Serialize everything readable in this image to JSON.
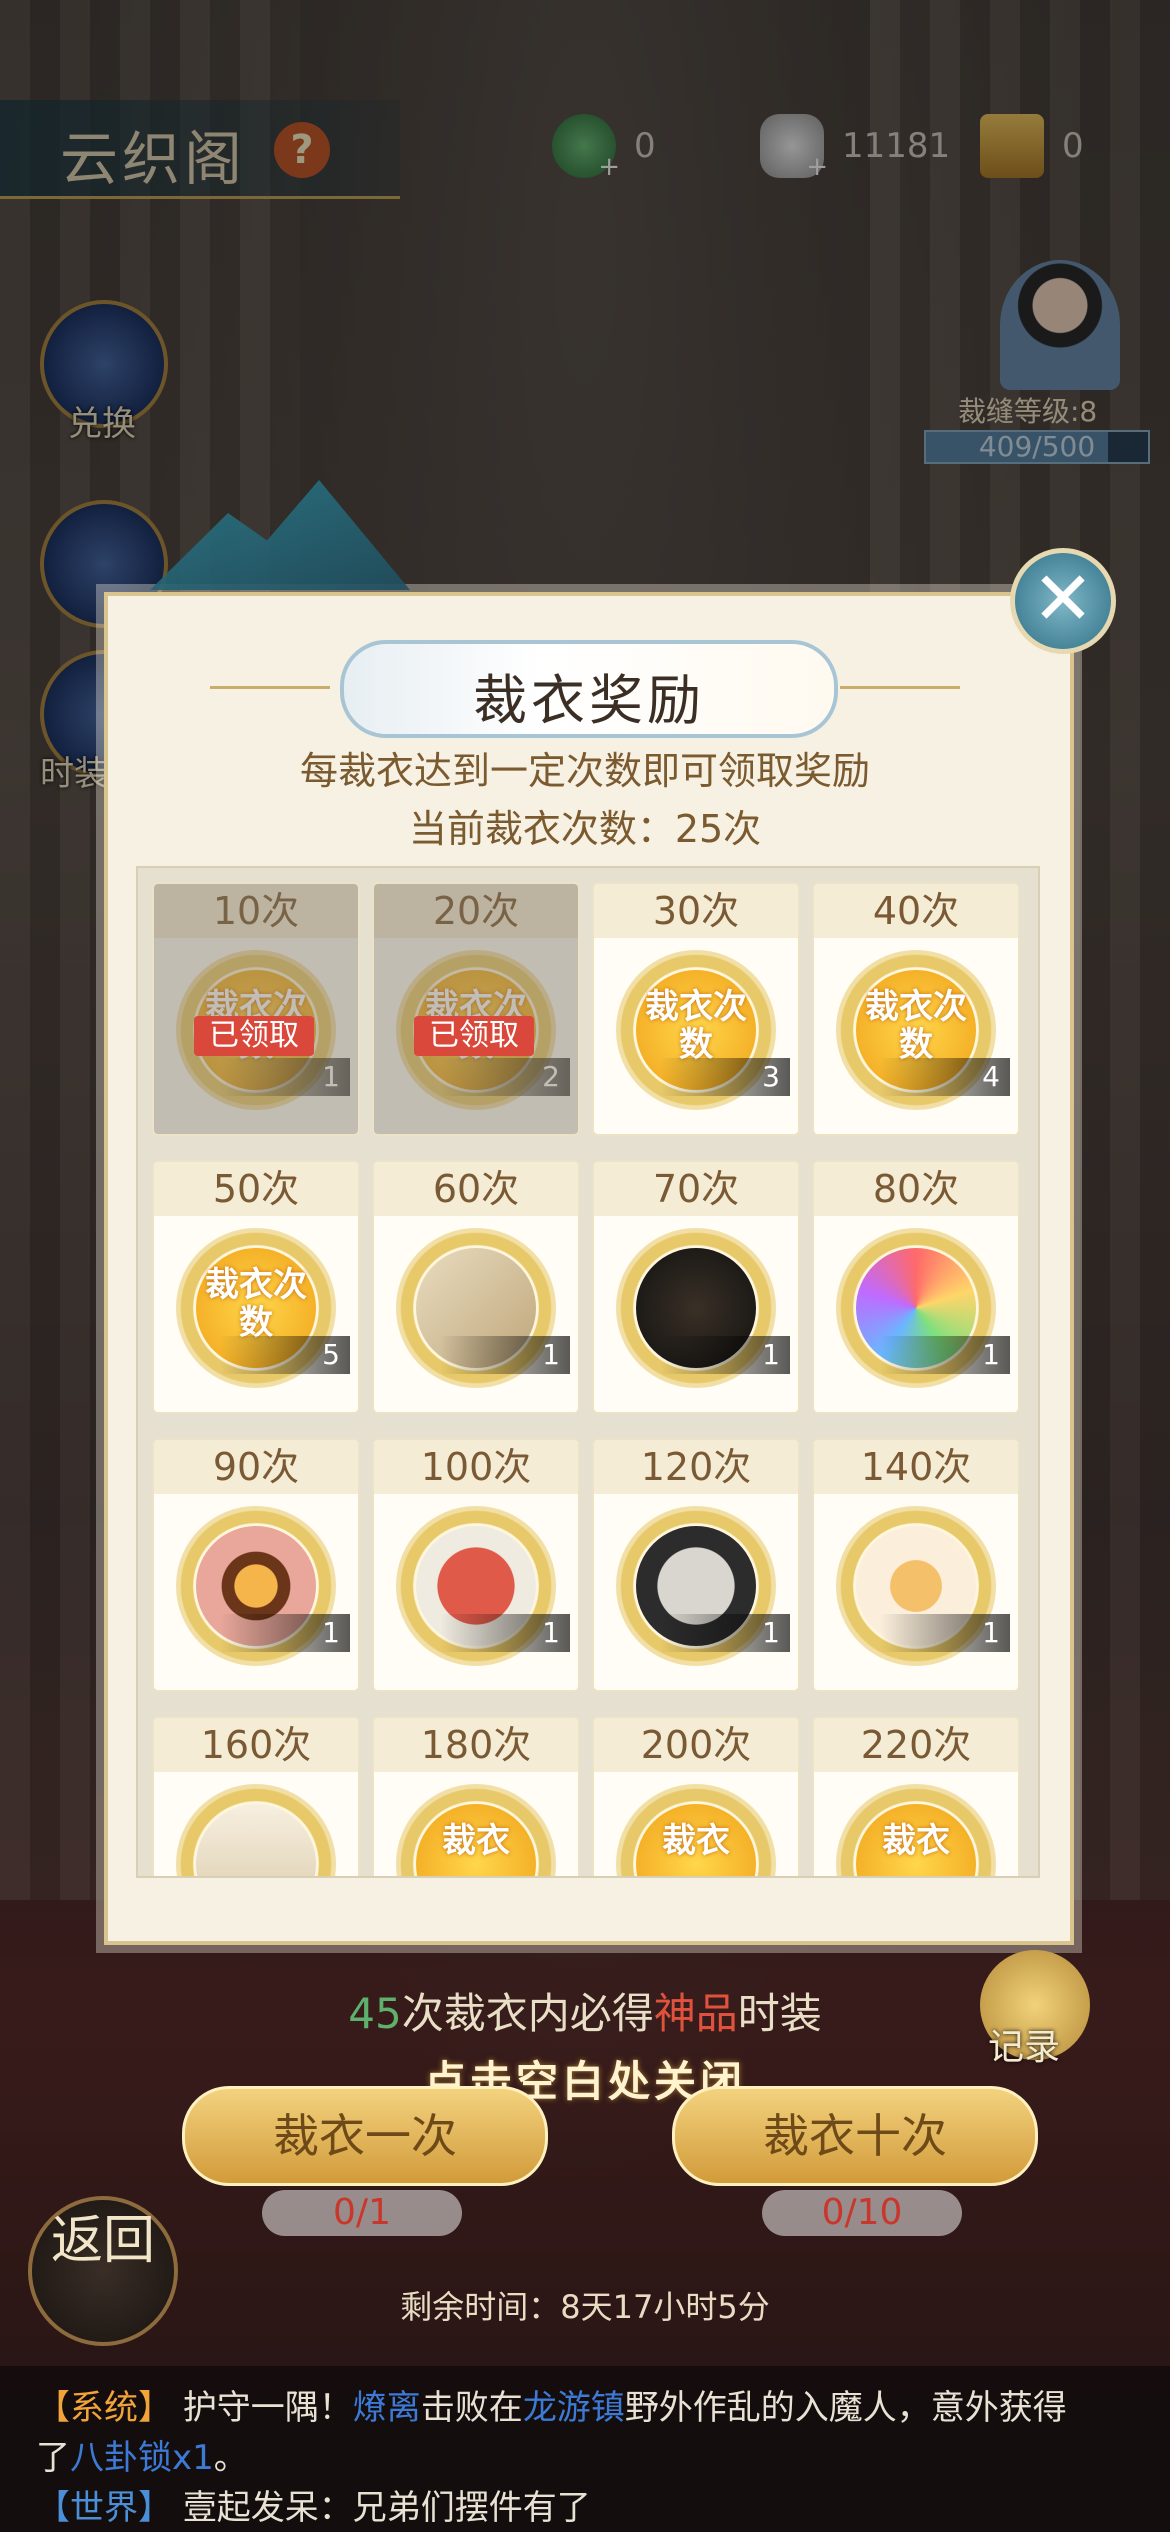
{
  "header": {
    "page_title": "云织阁",
    "help": "?",
    "currencies": [
      {
        "icon": "jade-coin-icon",
        "value": "0"
      },
      {
        "icon": "silver-ingot-icon",
        "value": "11181"
      },
      {
        "icon": "scroll-ticket-icon",
        "value": "0"
      }
    ]
  },
  "side": {
    "exchange_label": "兑换",
    "costume_label": "时装",
    "level_label": "裁缝等级:8",
    "xp_text": "409/500",
    "xp_fraction": 0.818
  },
  "modal": {
    "title": "裁衣奖励",
    "line1": "每裁衣达到一定次数即可领取奖励",
    "line2": "当前裁衣次数：25次",
    "claimed_label": "已领取",
    "cells": [
      {
        "label": "10次",
        "qty": "1",
        "kind": "ticket",
        "tag": "裁衣次数",
        "claimed": true
      },
      {
        "label": "20次",
        "qty": "2",
        "kind": "ticket",
        "tag": "裁衣次数",
        "claimed": true
      },
      {
        "label": "30次",
        "qty": "3",
        "kind": "ticket",
        "tag": "裁衣次数",
        "claimed": false
      },
      {
        "label": "40次",
        "qty": "4",
        "kind": "ticket",
        "tag": "裁衣次数",
        "claimed": false
      },
      {
        "label": "50次",
        "qty": "5",
        "kind": "ticket",
        "tag": "裁衣次数",
        "claimed": false
      },
      {
        "label": "60次",
        "qty": "1",
        "kind": "hairpin-box",
        "tag": "",
        "claimed": false
      },
      {
        "label": "70次",
        "qty": "1",
        "kind": "jewel-box",
        "tag": "",
        "claimed": false
      },
      {
        "label": "80次",
        "qty": "1",
        "kind": "rainbow-palette",
        "tag": "",
        "claimed": false
      },
      {
        "label": "90次",
        "qty": "1",
        "kind": "mirror",
        "tag": "",
        "claimed": false
      },
      {
        "label": "100次",
        "qty": "1",
        "kind": "rouge-box",
        "tag": "",
        "claimed": false
      },
      {
        "label": "120次",
        "qty": "1",
        "kind": "silver-box",
        "tag": "",
        "claimed": false
      },
      {
        "label": "140次",
        "qty": "1",
        "kind": "gold-bowl",
        "tag": "",
        "claimed": false
      },
      {
        "label": "160次",
        "qty": "",
        "kind": "frame",
        "tag": "",
        "claimed": false
      },
      {
        "label": "180次",
        "qty": "",
        "kind": "ticket",
        "tag": "裁衣",
        "claimed": false
      },
      {
        "label": "200次",
        "qty": "",
        "kind": "ticket",
        "tag": "裁衣",
        "claimed": false
      },
      {
        "label": "220次",
        "qty": "",
        "kind": "ticket",
        "tag": "裁衣",
        "claimed": false
      }
    ]
  },
  "bottom": {
    "guarantee_num": "45",
    "guarantee_pre": "次裁衣内必得",
    "guarantee_rare": "神品",
    "guarantee_post": "时装",
    "hint": "点击空白处关闭",
    "record_label": "记录",
    "btn_once": "裁衣一次",
    "btn_ten": "裁衣十次",
    "cost_once": "0/1",
    "cost_ten": "0/10",
    "remaining": "剩余时间：8天17小时5分",
    "back_label": "返回"
  },
  "chat": {
    "sys_tag": "【系统】",
    "sys_text1": "护守一隅！",
    "sys_name": "燎离",
    "sys_text2": "击败在",
    "sys_place": "龙游镇",
    "sys_text3": "野外作乱的入魔人，意外获得",
    "sys_text4": "了",
    "sys_item": "八卦锁x1",
    "sys_text5": "。",
    "world_tag": "【世界】",
    "world_text": "壹起发呆：兄弟们摆件有了"
  },
  "colors": {
    "accent_gold": "#d29b3a",
    "claimed_red": "#d9483a",
    "guarantee_green": "#5fb06c",
    "rare_red": "#e0523e"
  }
}
